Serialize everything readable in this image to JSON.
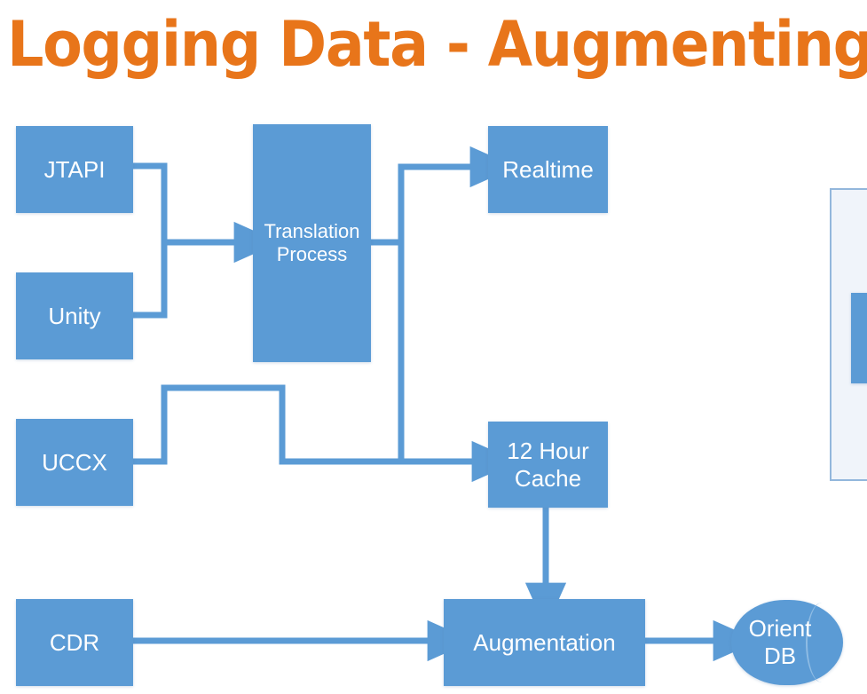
{
  "slide": {
    "title": "Logging Data - Augmenting CDR",
    "title_color": "#E8751A",
    "background_color": "#FFFFFF"
  },
  "theme": {
    "node_fill": "#5B9BD5",
    "node_text": "#FFFFFF",
    "connector_color": "#5B9BD5",
    "panel_fill": "#F0F4FA",
    "panel_border": "#93B7DC"
  },
  "diagram": {
    "type": "flowchart",
    "nodes": [
      {
        "id": "jtapi",
        "label": "JTAPI",
        "shape": "rectangle"
      },
      {
        "id": "unity",
        "label": "Unity",
        "shape": "rectangle"
      },
      {
        "id": "uccx",
        "label": "UCCX",
        "shape": "rectangle"
      },
      {
        "id": "translation",
        "label": "Translation\nProcess",
        "shape": "rectangle"
      },
      {
        "id": "realtime",
        "label": "Realtime",
        "shape": "rectangle"
      },
      {
        "id": "cache",
        "label": "12 Hour\nCache",
        "shape": "rectangle"
      },
      {
        "id": "cdr",
        "label": "CDR",
        "shape": "rectangle"
      },
      {
        "id": "augmentation",
        "label": "Augmentation",
        "shape": "rectangle"
      },
      {
        "id": "orientdb",
        "label": "Orient\nDB",
        "shape": "cylinder"
      }
    ],
    "edges": [
      {
        "from": "jtapi",
        "to": "translation",
        "style": "orthogonal"
      },
      {
        "from": "unity",
        "to": "translation",
        "style": "orthogonal"
      },
      {
        "from": "uccx",
        "to": "cache",
        "style": "orthogonal"
      },
      {
        "from": "translation",
        "to": "realtime",
        "style": "orthogonal"
      },
      {
        "from": "translation",
        "to": "cache",
        "style": "orthogonal"
      },
      {
        "from": "cache",
        "to": "augmentation",
        "style": "straight"
      },
      {
        "from": "cdr",
        "to": "augmentation",
        "style": "straight"
      },
      {
        "from": "augmentation",
        "to": "orientdb",
        "style": "straight"
      }
    ]
  },
  "side_panel": {
    "visible_portion": "partial",
    "inner_shape": "rectangle"
  }
}
